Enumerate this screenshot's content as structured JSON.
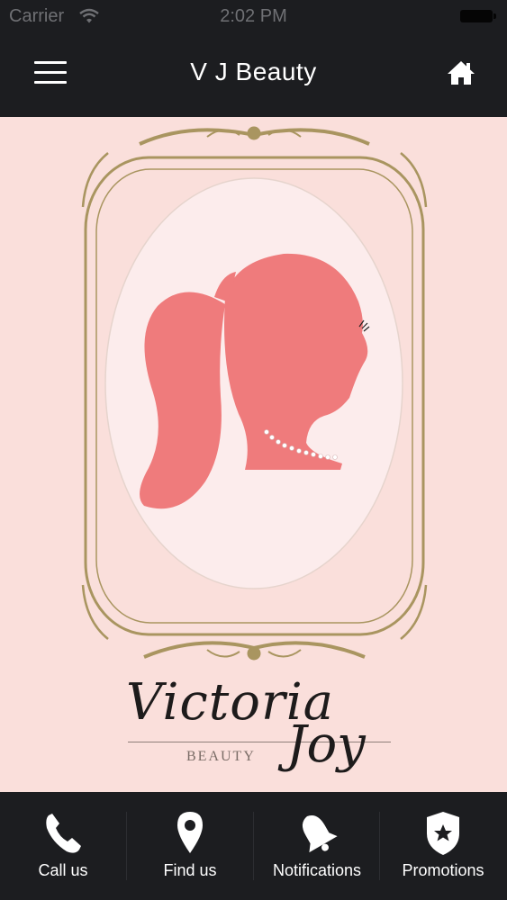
{
  "status_bar": {
    "carrier": "Carrier",
    "time": "2:02 PM"
  },
  "nav": {
    "title": "V J Beauty",
    "menu_icon": "hamburger-icon",
    "home_icon": "home-icon"
  },
  "hero": {
    "brand_name": "Victoria",
    "brand_joy": "Joy",
    "brand_sub": "BEAUTY",
    "colors": {
      "background": "#fadfdb",
      "silhouette": "#ef7b7c",
      "frame": "#a99560",
      "oval": "#fcecec"
    }
  },
  "tabs": [
    {
      "label": "Call us",
      "icon": "phone-icon"
    },
    {
      "label": "Find us",
      "icon": "map-pin-icon"
    },
    {
      "label": "Notifications",
      "icon": "bell-icon"
    },
    {
      "label": "Promotions",
      "icon": "star-badge-icon"
    }
  ]
}
